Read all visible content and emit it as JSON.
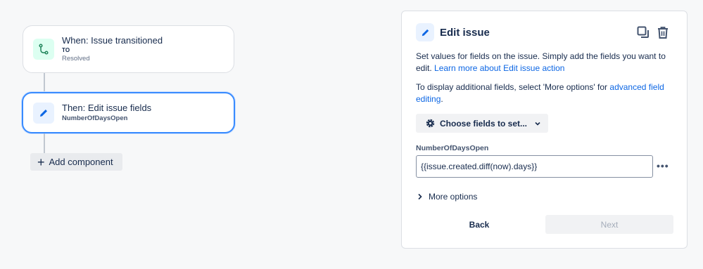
{
  "flow": {
    "trigger": {
      "title": "When: Issue transitioned",
      "to_label": "TO",
      "to_value": "Resolved",
      "icon": "branch-icon",
      "accent": "#1f845a"
    },
    "action": {
      "title": "Then: Edit issue fields",
      "field": "NumberOfDaysOpen",
      "icon": "pencil-icon",
      "accent": "#0c66e4"
    },
    "add_component_label": "Add component"
  },
  "panel": {
    "title": "Edit issue",
    "desc1_text": "Set values for fields on the issue. Simply add the fields you want to edit.",
    "desc1_link": "Learn more about Edit issue action",
    "desc2_text": "To display additional fields, select 'More options' for",
    "desc2_link": "advanced field editing",
    "desc2_end": ".",
    "choose_fields_label": "Choose fields to set...",
    "field_label": "NumberOfDaysOpen",
    "field_value": "{{issue.created.diff(now).days}}",
    "more_options_label": "More options",
    "back_label": "Back",
    "next_label": "Next"
  }
}
